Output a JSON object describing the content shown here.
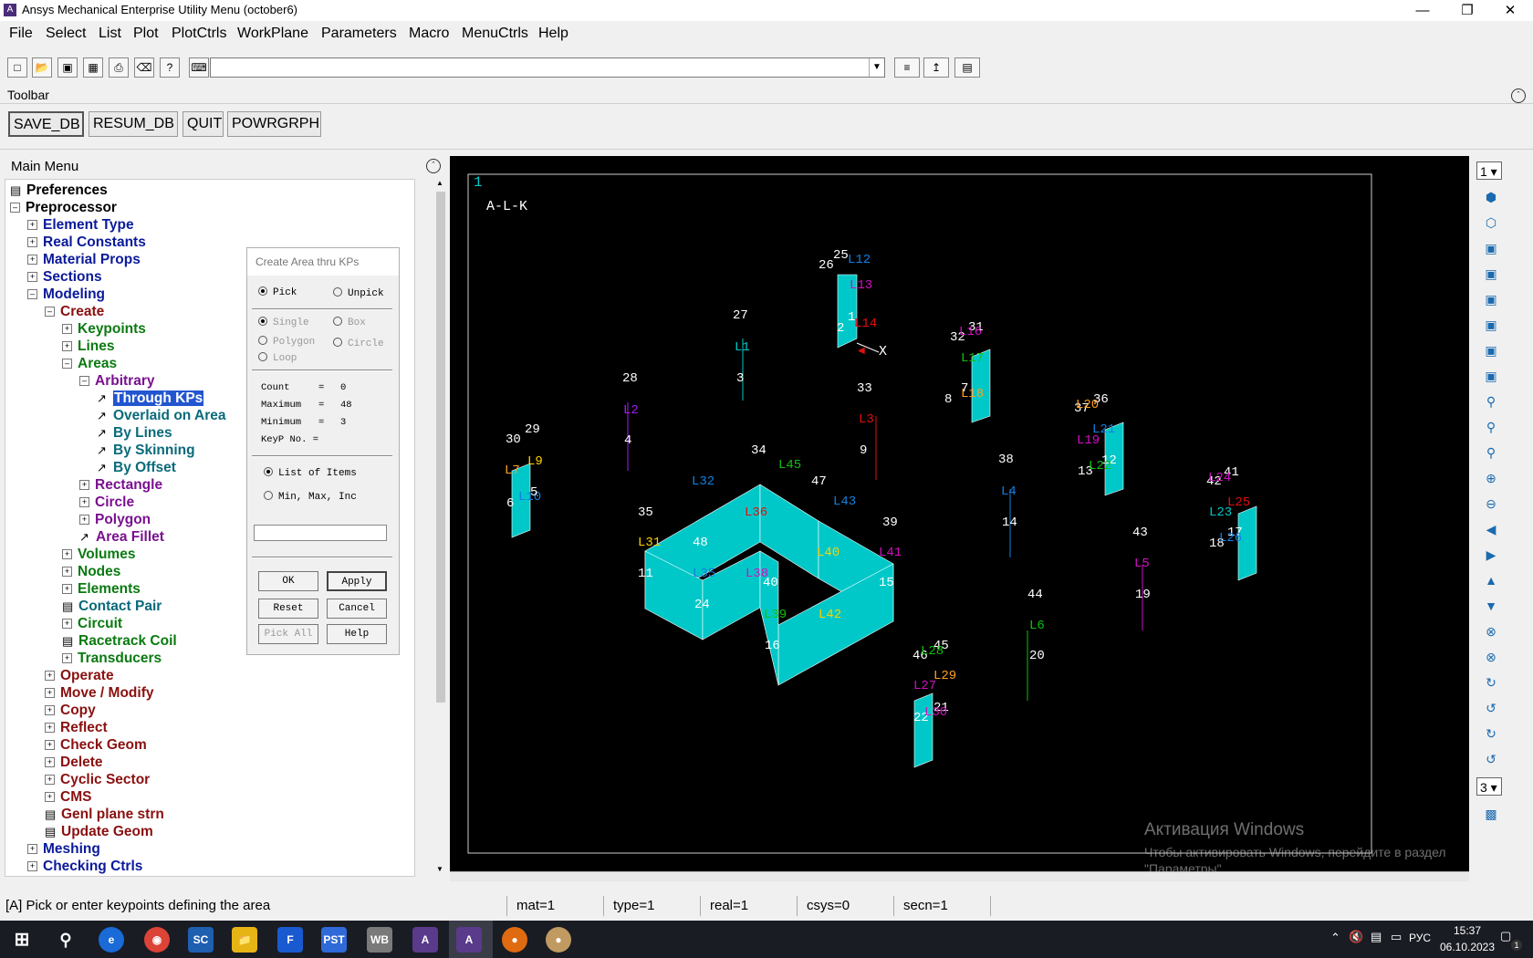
{
  "window": {
    "title": "Ansys Mechanical Enterprise Utility Menu (october6)",
    "app_icon": "A"
  },
  "menubar": [
    "File",
    "Select",
    "List",
    "Plot",
    "PlotCtrls",
    "WorkPlane",
    "Parameters",
    "Macro",
    "MenuCtrls",
    "Help"
  ],
  "toolbar": {
    "header": "Toolbar",
    "buttons": [
      "SAVE_DB",
      "RESUM_DB",
      "QUIT",
      "POWRGRPH"
    ]
  },
  "main_menu": {
    "header": "Main Menu",
    "items": [
      {
        "label": "Preferences"
      },
      {
        "label": "Preprocessor"
      },
      {
        "label": "Element Type"
      },
      {
        "label": "Real Constants"
      },
      {
        "label": "Material Props"
      },
      {
        "label": "Sections"
      },
      {
        "label": "Modeling"
      },
      {
        "label": "Create"
      },
      {
        "label": "Keypoints"
      },
      {
        "label": "Lines"
      },
      {
        "label": "Areas"
      },
      {
        "label": "Arbitrary"
      },
      {
        "label": "Through KPs"
      },
      {
        "label": "Overlaid on Area"
      },
      {
        "label": "By Lines"
      },
      {
        "label": "By Skinning"
      },
      {
        "label": "By Offset"
      },
      {
        "label": "Rectangle"
      },
      {
        "label": "Circle"
      },
      {
        "label": "Polygon"
      },
      {
        "label": "Area Fillet"
      },
      {
        "label": "Volumes"
      },
      {
        "label": "Nodes"
      },
      {
        "label": "Elements"
      },
      {
        "label": "Contact Pair"
      },
      {
        "label": "Circuit"
      },
      {
        "label": "Racetrack Coil"
      },
      {
        "label": "Transducers"
      },
      {
        "label": "Operate"
      },
      {
        "label": "Move / Modify"
      },
      {
        "label": "Copy"
      },
      {
        "label": "Reflect"
      },
      {
        "label": "Check Geom"
      },
      {
        "label": "Delete"
      },
      {
        "label": "Cyclic Sector"
      },
      {
        "label": "CMS"
      },
      {
        "label": "Genl plane strn"
      },
      {
        "label": "Update Geom"
      },
      {
        "label": "Meshing"
      },
      {
        "label": "Checking Ctrls"
      }
    ]
  },
  "dialog": {
    "title": "Create Area thru KPs",
    "pick": "Pick",
    "unpick": "Unpick",
    "single": "Single",
    "box": "Box",
    "polygon": "Polygon",
    "circle": "Circle",
    "loop": "Loop",
    "count_label": "Count",
    "count": "0",
    "max_label": "Maximum",
    "max": "48",
    "min_label": "Minimum",
    "min": "3",
    "keyp_label": "KeyP No. =",
    "list_items": "List of Items",
    "min_max_inc": "Min, Max, Inc",
    "ok": "OK",
    "apply": "Apply",
    "reset": "Reset",
    "cancel": "Cancel",
    "pick_all": "Pick All",
    "help": "Help"
  },
  "graphics": {
    "window_number": "1",
    "plot_title": "A-L-K",
    "axis_x": "X",
    "watermark_line1": "Активация Windows",
    "watermark_line2": "Чтобы активировать Windows, перейдите в раздел",
    "watermark_line3": "\"Параметры\".",
    "labels": [
      "25",
      "L12",
      "26",
      "L13",
      "L14",
      "27",
      "L1",
      "3",
      "32",
      "31",
      "L16",
      "L17",
      "L18",
      "28",
      "L2",
      "4",
      "33",
      "L3",
      "9",
      "37",
      "36",
      "L20",
      "L21",
      "L19",
      "12",
      "13",
      "L22",
      "30",
      "29",
      "L9",
      "L7",
      "L10",
      "34",
      "L45",
      "47",
      "L32",
      "L43",
      "L36",
      "35",
      "39",
      "L31",
      "48",
      "L40",
      "L41",
      "L35",
      "L38",
      "40",
      "11",
      "15",
      "L39",
      "L42",
      "24",
      "16",
      "38",
      "L4",
      "14",
      "42",
      "41",
      "L24",
      "L25",
      "L23",
      "17",
      "18",
      "L26",
      "43",
      "L5",
      "19",
      "44",
      "L6",
      "20",
      "46",
      "45",
      "L28",
      "L29",
      "L27",
      "21",
      "22",
      "L30",
      "5",
      "6",
      "7",
      "8",
      "1",
      "2"
    ]
  },
  "right_toolbar": {
    "window_select": "1",
    "view_select": "3"
  },
  "status": {
    "prompt": "[A]  Pick or enter keypoints defining the area",
    "mat": "mat=1",
    "type": "type=1",
    "real": "real=1",
    "csys": "csys=0",
    "secn": "secn=1"
  },
  "taskbar": {
    "apps": [
      "SC",
      "F",
      "PST",
      "WB",
      "A",
      "A"
    ],
    "lang": "РУС",
    "time": "15:37",
    "date": "06.10.2023",
    "notif": "1"
  },
  "colors": {
    "selection": "#2255d0",
    "area_fill": "#00c8c8",
    "graphics_bg": "#000000"
  }
}
